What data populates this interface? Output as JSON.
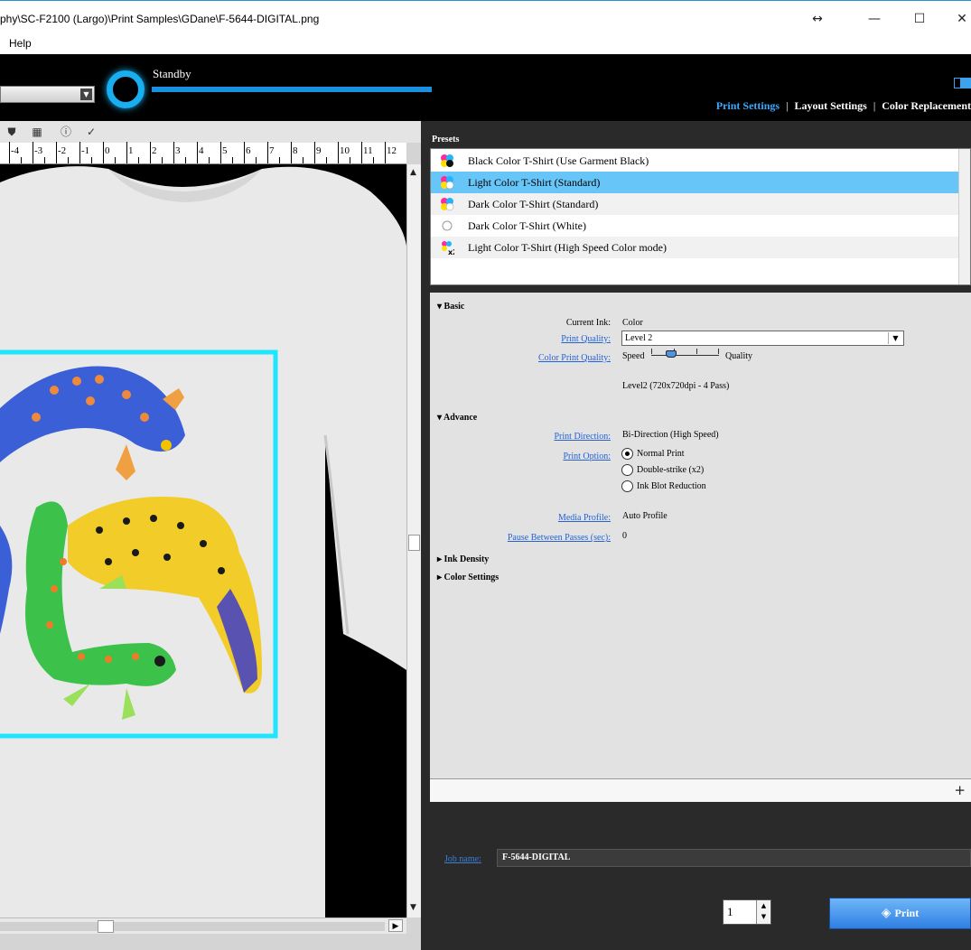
{
  "window": {
    "title": "phy\\SC-F2100 (Largo)\\Print Samples\\GDane\\F-5644-DIGITAL.png",
    "controls": {
      "resize": "↔",
      "minimize": "—",
      "maximize": "☐",
      "close": "✕"
    }
  },
  "menu": {
    "help": "Help"
  },
  "header": {
    "status": "Standby",
    "tabs": [
      "Print Settings",
      "Layout Settings",
      "Color Replacement"
    ],
    "active_tab": "Print Settings",
    "accent_color": "#19aef0"
  },
  "toolbar": {
    "icons": [
      "stamp-icon",
      "calculator-icon",
      "info-icon",
      "checklist-icon"
    ],
    "glyphs": [
      "⛊",
      "▦",
      "ⓘ",
      "✓"
    ]
  },
  "ruler": {
    "labels": [
      "-4",
      "-3",
      "-2",
      "-1",
      "0",
      "1",
      "2",
      "3",
      "4",
      "5",
      "6",
      "7",
      "8",
      "9",
      "10",
      "11",
      "12"
    ]
  },
  "presets": {
    "label": "Presets",
    "items": [
      {
        "label": "Black Color T-Shirt (Use Garment Black)",
        "icon": "cmyk-icon"
      },
      {
        "label": "Light Color T-Shirt (Standard)",
        "icon": "cmyk-icon",
        "selected": true
      },
      {
        "label": "Dark Color T-Shirt (Standard)",
        "icon": "cmyk-icon"
      },
      {
        "label": "Dark Color T-Shirt (White)",
        "icon": "white-circle-icon"
      },
      {
        "label": "Light Color T-Shirt (High Speed Color mode)",
        "icon": "cmyk-x2-icon"
      }
    ],
    "selected_color": "#67c5f7"
  },
  "basic": {
    "title": "Basic",
    "current_ink_label": "Current Ink:",
    "current_ink": "Color",
    "print_quality_label": "Print Quality:",
    "print_quality": "Level 2",
    "color_print_quality_label": "Color Print Quality:",
    "speed": "Speed",
    "quality": "Quality",
    "slider_level": 0.25,
    "level_desc": "Level2 (720x720dpi - 4 Pass)"
  },
  "advance": {
    "title": "Advance",
    "print_direction_label": "Print Direction:",
    "print_direction": "Bi-Direction (High Speed)",
    "print_option_label": "Print Option:",
    "options": [
      "Normal Print",
      "Double-strike (x2)",
      "Ink Blot Reduction"
    ],
    "selected_option": 0,
    "media_profile_label": "Media Profile:",
    "media_profile": "Auto Profile",
    "pause_label": "Pause Between Passes (sec):",
    "pause": "0"
  },
  "collapsed": {
    "ink_density": "Ink Density",
    "color_settings": "Color Settings"
  },
  "footer": {
    "job_label": "Job name:",
    "job_name": "F-5644-DIGITAL",
    "copies": "1",
    "print": "Print"
  }
}
